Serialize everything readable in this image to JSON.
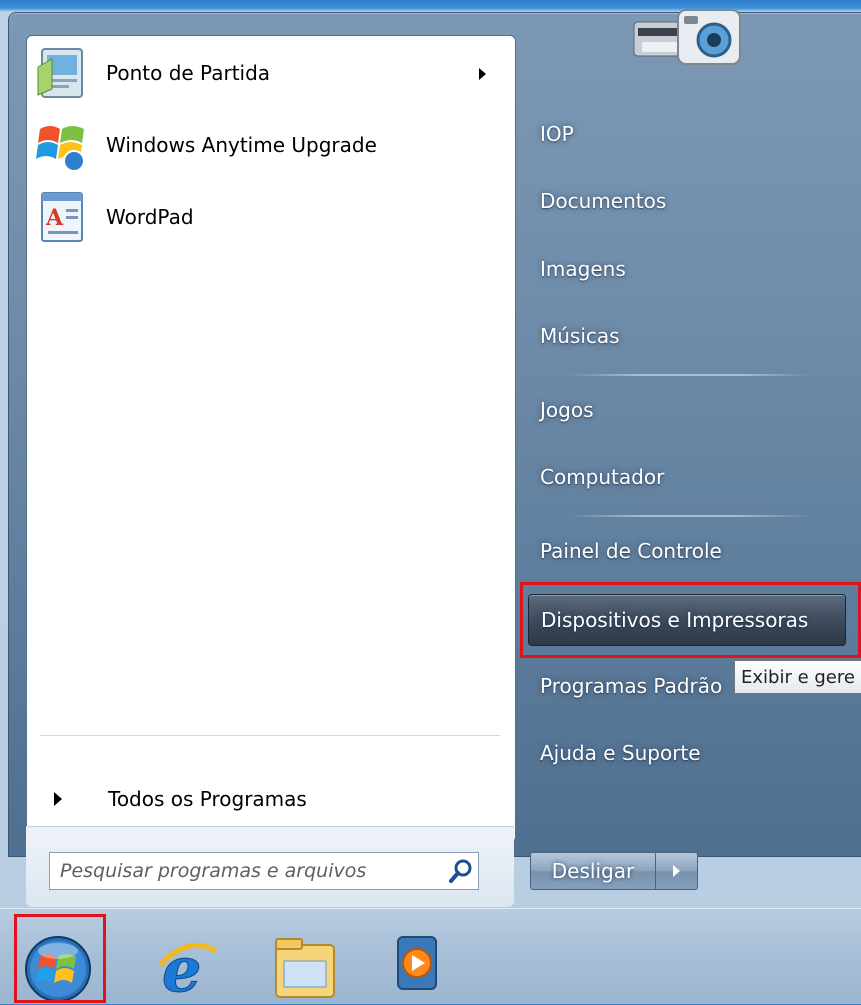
{
  "programs": [
    {
      "label": "Ponto de Partida",
      "icon": "getting-started-icon",
      "has_submenu": true
    },
    {
      "label": "Windows Anytime Upgrade",
      "icon": "windows-flag-icon",
      "has_submenu": false
    },
    {
      "label": "WordPad",
      "icon": "wordpad-icon",
      "has_submenu": false
    }
  ],
  "all_programs": {
    "label": "Todos os Programas"
  },
  "search": {
    "placeholder": "Pesquisar programas e arquivos"
  },
  "places": [
    {
      "label": "IOP"
    },
    {
      "label": "Documentos"
    },
    {
      "label": "Imagens"
    },
    {
      "label": "Músicas"
    },
    {
      "label": "Jogos"
    },
    {
      "label": "Computador"
    },
    {
      "label": "Painel de Controle"
    },
    {
      "label": "Dispositivos e Impressoras",
      "highlighted": true
    },
    {
      "label": "Programas Padrão"
    },
    {
      "label": "Ajuda e Suporte"
    }
  ],
  "tooltip": {
    "text": "Exibir e gere"
  },
  "shutdown": {
    "label": "Desligar"
  },
  "taskbar": {
    "items": [
      "start-orb-icon",
      "internet-explorer-icon",
      "windows-explorer-icon",
      "media-player-icon"
    ]
  },
  "colors": {
    "highlight_box": "#e0121a",
    "menu_frame": "#6f8daa"
  }
}
